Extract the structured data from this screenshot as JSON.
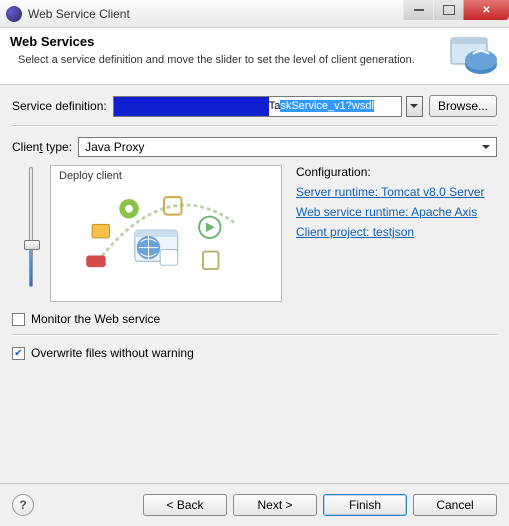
{
  "window": {
    "title": "Web Service Client"
  },
  "banner": {
    "heading": "Web Services",
    "description": "Select a service definition and move the slider to set the level of client generation."
  },
  "service_definition": {
    "label": "Service definition:",
    "value_visible_prefix": "Ta",
    "value_visible_selected": "skService_v1?wsdl",
    "browse_label": "Browse..."
  },
  "client_type": {
    "label": "Client type:",
    "value": "Java Proxy"
  },
  "diagram": {
    "label": "Deploy client"
  },
  "config": {
    "title": "Configuration:",
    "links": {
      "runtime": "Server runtime: Tomcat v8.0 Server",
      "ws_runtime": "Web service runtime: Apache Axis",
      "project": "Client project: testjson"
    }
  },
  "options": {
    "monitor": {
      "label": "Monitor the Web service",
      "checked": false
    },
    "overwrite": {
      "label": "Overwrite files without warning",
      "checked": true
    }
  },
  "buttons": {
    "back": "< Back",
    "next": "Next >",
    "finish": "Finish",
    "cancel": "Cancel",
    "help": "?"
  }
}
